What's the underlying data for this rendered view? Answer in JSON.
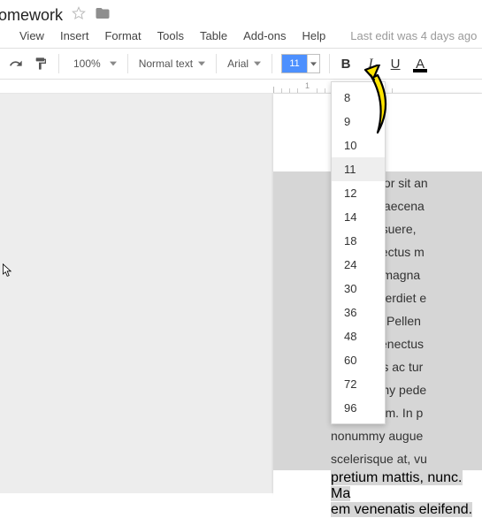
{
  "doc": {
    "title": "omework"
  },
  "menus": {
    "view": "View",
    "insert": "Insert",
    "format": "Format",
    "tools": "Tools",
    "table": "Table",
    "addons": "Add-ons",
    "help": "Help"
  },
  "status": {
    "last_edit": "Last edit was 4 days ago"
  },
  "toolbar": {
    "zoom": "100%",
    "style": "Normal text",
    "font": "Arial",
    "font_size": "11",
    "bold": "B",
    "italic": "I",
    "underline": "U",
    "textcolor": "A"
  },
  "font_size_menu": {
    "selected": "11",
    "options": [
      "8",
      "9",
      "10",
      "11",
      "12",
      "14",
      "18",
      "24",
      "30",
      "36",
      "48",
      "60",
      "72",
      "96"
    ]
  },
  "body": {
    "lines": [
      "ipsum dolor sit an",
      "ing elit. Maecena",
      "Fusce posuere,",
      "s, purus lectus m",
      "ommodo magna ",
      "iverra imperdiet e",
      "s a tellus. Pellen",
      "ristique senectus",
      "ada fames ac tur",
      "a nonummy pede",
      "n nec lorem. In p",
      "nonummy augue",
      "scelerisque at, vu"
    ],
    "last_line": "pretium mattis, nunc. Ma",
    "tail": "em venenatis eleifend."
  }
}
